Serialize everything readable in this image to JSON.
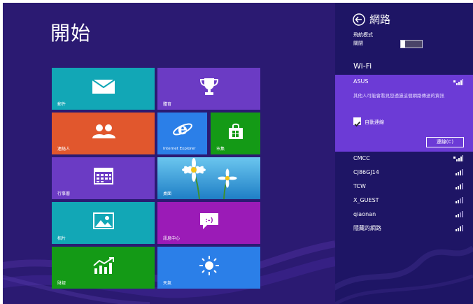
{
  "start": {
    "title": "開始"
  },
  "tiles": [
    {
      "key": "mail",
      "label": "郵件"
    },
    {
      "key": "sports",
      "label": "體育"
    },
    {
      "key": "people",
      "label": "連絡人"
    },
    {
      "key": "ie",
      "label": "Internet Explorer"
    },
    {
      "key": "store",
      "label": "市集"
    },
    {
      "key": "calendar",
      "label": "行事曆"
    },
    {
      "key": "desktop",
      "label": "桌面"
    },
    {
      "key": "photos",
      "label": "相片"
    },
    {
      "key": "messaging",
      "label": "訊息中心"
    },
    {
      "key": "finance",
      "label": "財經"
    },
    {
      "key": "weather",
      "label": "天氣"
    }
  ],
  "network": {
    "title": "網路",
    "airplane_label": "飛航模式",
    "airplane_state": "關閉",
    "wifi_header": "Wi-Fi",
    "selected": {
      "name": "ASUS",
      "warning": "其他人可能會看見您透過這個網路傳送的資訊",
      "auto_connect_label": "自動連線",
      "auto_connect_checked": true,
      "connect_button": "連線(C)"
    },
    "others": [
      "CMCC",
      "CJ86GJ14",
      "TCW",
      "X_GUEST",
      "qiaonan",
      "隱藏的網路"
    ]
  },
  "colors": {
    "start_bg": "#2b1a72",
    "panel_bg": "#1e1565",
    "selected_bg": "#6c3bd6",
    "tile_teal": "#12a7b6",
    "tile_purple": "#6b3bc4",
    "tile_orange": "#e1572d",
    "tile_blue": "#2b7fe8",
    "tile_green": "#149a16",
    "tile_magenta": "#9b1bb7"
  },
  "icons": {
    "back": "back-arrow-icon",
    "wifi": "wifi-signal-icon",
    "checkbox": "checkbox-icon"
  }
}
